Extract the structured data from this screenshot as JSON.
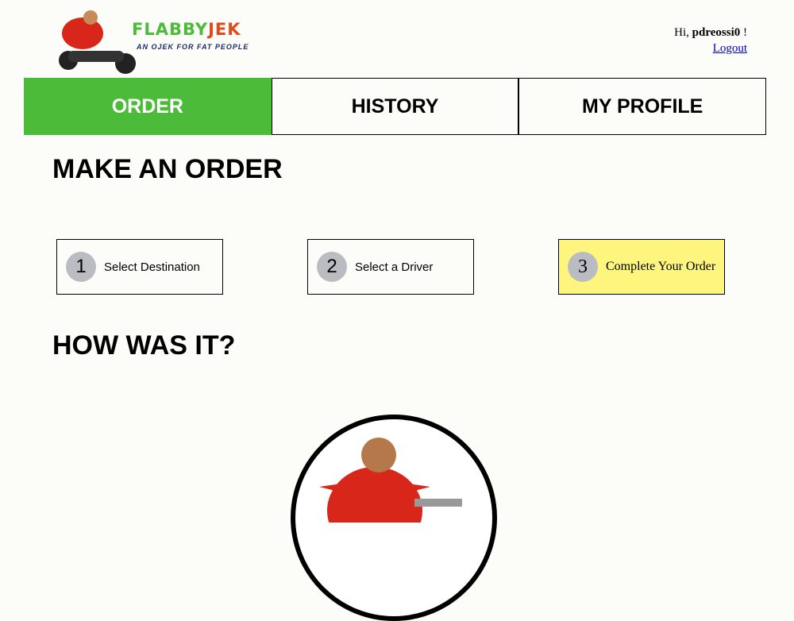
{
  "brand": {
    "name_part1": "FLABBY",
    "name_part2": "JEK",
    "tagline": "AN OJEK FOR FAT PEOPLE"
  },
  "user": {
    "greeting": "Hi,",
    "username": "pdreossi0",
    "suffix": "!",
    "logout": "Logout"
  },
  "nav": {
    "tabs": [
      {
        "label": "ORDER",
        "active": true
      },
      {
        "label": "HISTORY"
      },
      {
        "label": "MY PROFILE"
      }
    ]
  },
  "main": {
    "title": "MAKE AN ORDER",
    "steps": [
      {
        "num": "1",
        "label": "Select Destination"
      },
      {
        "num": "2",
        "label": "Select a Driver"
      },
      {
        "num": "3",
        "label": "Complete Your Order",
        "current": true
      }
    ],
    "rating_title": "HOW WAS IT?"
  },
  "colors": {
    "accent": "#4cbb3a",
    "current_step": "#fdf57e"
  }
}
